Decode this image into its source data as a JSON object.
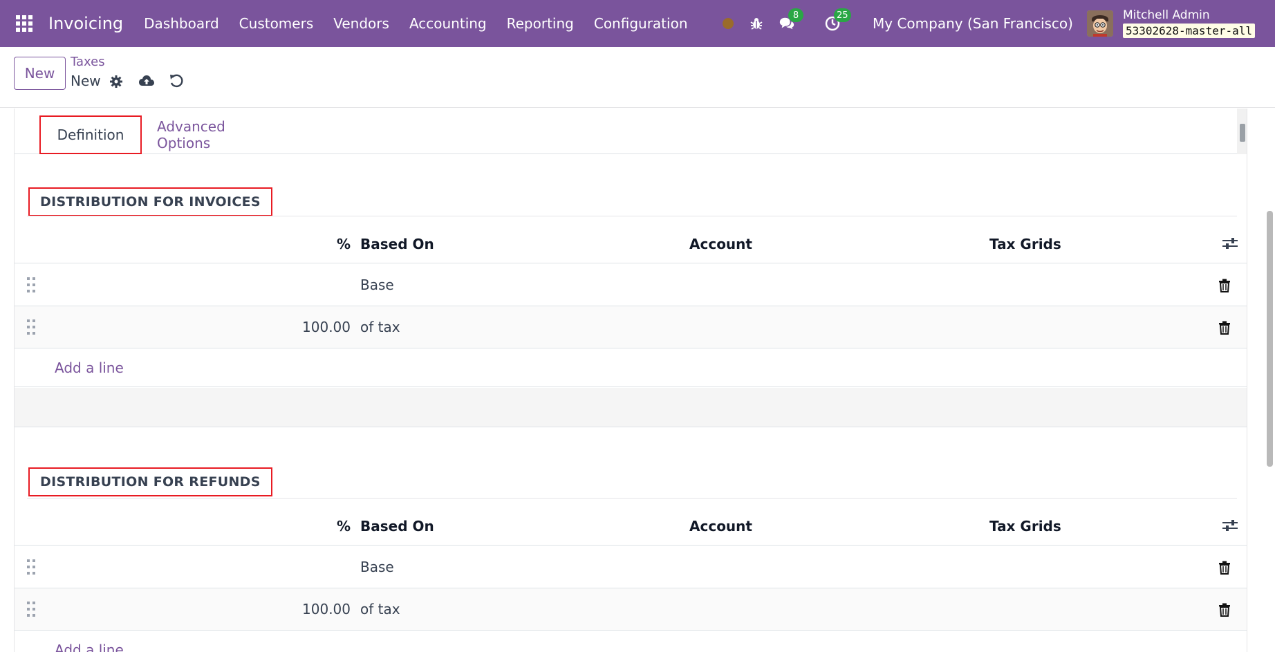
{
  "navbar": {
    "app_name": "Invoicing",
    "menu": [
      "Dashboard",
      "Customers",
      "Vendors",
      "Accounting",
      "Reporting",
      "Configuration"
    ],
    "messages_count": "8",
    "activities_count": "25",
    "company": "My Company (San Francisco)",
    "user_name": "Mitchell Admin",
    "database": "53302628-master-all",
    "brand_color": "#7a549c"
  },
  "control_panel": {
    "new_label": "New",
    "breadcrumb": "Taxes",
    "record_name": "New"
  },
  "tabs": {
    "definition": "Definition",
    "advanced": "Advanced Options"
  },
  "invoices": {
    "title": "DISTRIBUTION FOR INVOICES",
    "columns": {
      "pct": "%",
      "based_on": "Based On",
      "account": "Account",
      "tax_grids": "Tax Grids"
    },
    "rows": [
      {
        "pct": "",
        "based_on": "Base"
      },
      {
        "pct": "100.00",
        "based_on": "of tax"
      }
    ],
    "add_line": "Add a line"
  },
  "refunds": {
    "title": "DISTRIBUTION FOR REFUNDS",
    "columns": {
      "pct": "%",
      "based_on": "Based On",
      "account": "Account",
      "tax_grids": "Tax Grids"
    },
    "rows": [
      {
        "pct": "",
        "based_on": "Base"
      },
      {
        "pct": "100.00",
        "based_on": "of tax"
      }
    ],
    "add_line": "Add a line"
  }
}
